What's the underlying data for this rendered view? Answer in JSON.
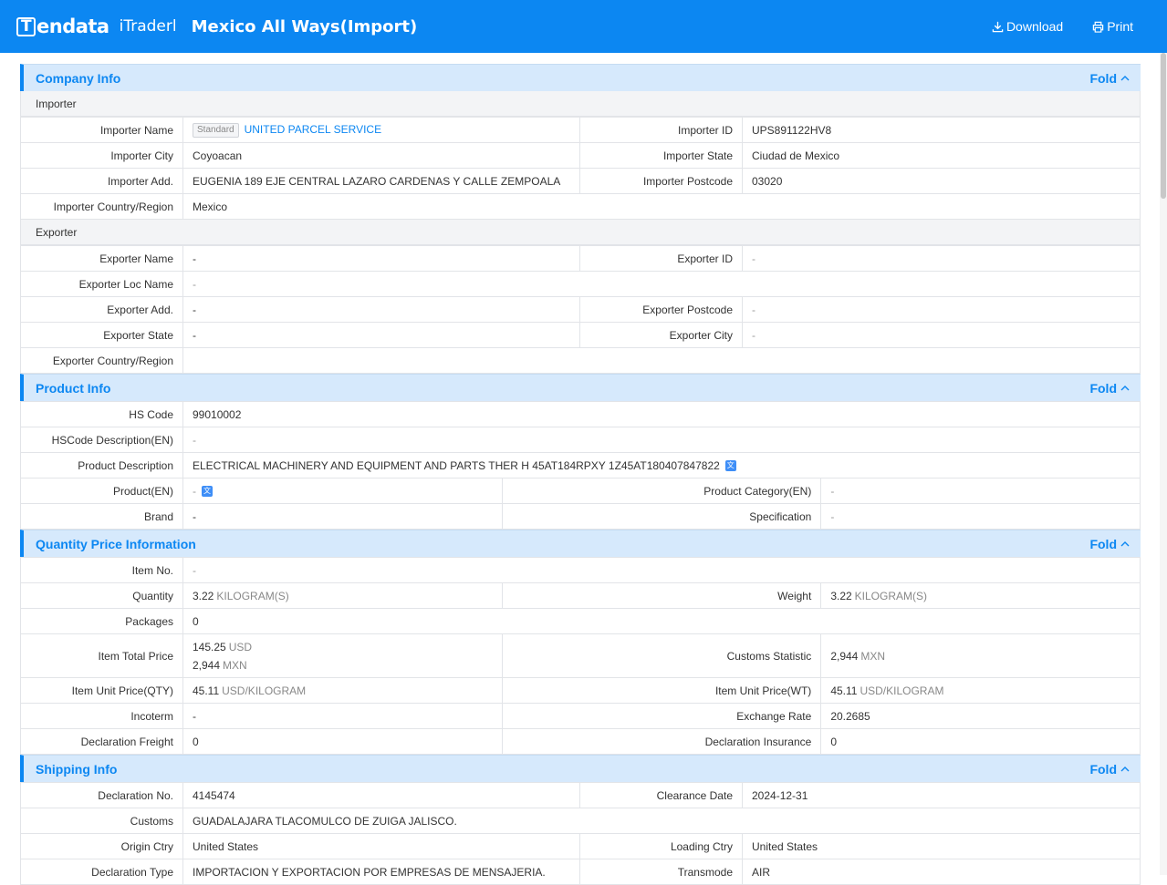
{
  "header": {
    "brand": "endata",
    "brand_letter": "T",
    "product": "iTraderl",
    "title": "Mexico All Ways(Import)",
    "download": "Download",
    "print": "Print"
  },
  "fold_label": "Fold",
  "company": {
    "title": "Company Info",
    "importer_sub": "Importer",
    "exporter_sub": "Exporter",
    "importer_name_label": "Importer Name",
    "importer_name_tag": "Standard",
    "importer_name": "UNITED PARCEL SERVICE",
    "importer_id_label": "Importer ID",
    "importer_id": "UPS891122HV8",
    "importer_city_label": "Importer City",
    "importer_city": "Coyoacan",
    "importer_state_label": "Importer State",
    "importer_state": "Ciudad de Mexico",
    "importer_add_label": "Importer Add.",
    "importer_add": "EUGENIA 189 EJE CENTRAL LAZARO CARDENAS Y CALLE ZEMPOALA",
    "importer_postcode_label": "Importer Postcode",
    "importer_postcode": "03020",
    "importer_country_label": "Importer Country/Region",
    "importer_country": "Mexico",
    "exporter_name_label": "Exporter Name",
    "exporter_name": "-",
    "exporter_id_label": "Exporter ID",
    "exporter_id": "-",
    "exporter_loc_label": "Exporter Loc Name",
    "exporter_loc": "-",
    "exporter_add_label": "Exporter Add.",
    "exporter_add": "-",
    "exporter_postcode_label": "Exporter Postcode",
    "exporter_postcode": "-",
    "exporter_state_label": "Exporter State",
    "exporter_state": "-",
    "exporter_city_label": "Exporter City",
    "exporter_city": "-",
    "exporter_country_label": "Exporter Country/Region",
    "exporter_country": ""
  },
  "product": {
    "title": "Product Info",
    "hs_label": "HS Code",
    "hs": "99010002",
    "hsdesc_label": "HSCode Description(EN)",
    "hsdesc": "-",
    "desc_label": "Product Description",
    "desc": "ELECTRICAL MACHINERY AND EQUIPMENT AND PARTS THER H 45AT184RPXY 1Z45AT180407847822",
    "product_en_label": "Product(EN)",
    "product_en": "-",
    "category_label": "Product Category(EN)",
    "category": "-",
    "brand_label": "Brand",
    "brand": "-",
    "spec_label": "Specification",
    "spec": "-",
    "translate_glyph": "文"
  },
  "quantity": {
    "title": "Quantity Price Information",
    "item_no_label": "Item No.",
    "item_no": "-",
    "qty_label": "Quantity",
    "qty": "3.22",
    "qty_unit": "KILOGRAM(S)",
    "weight_label": "Weight",
    "weight": "3.22",
    "weight_unit": "KILOGRAM(S)",
    "packages_label": "Packages",
    "packages": "0",
    "total_label": "Item Total Price",
    "total_usd": "145.25",
    "total_usd_unit": "USD",
    "total_mxn": "2,944",
    "total_mxn_unit": "MXN",
    "customs_stat_label": "Customs Statistic",
    "customs_stat": "2,944",
    "customs_stat_unit": "MXN",
    "unit_qty_label": "Item Unit Price(QTY)",
    "unit_qty": "45.11",
    "unit_qty_unit": "USD/KILOGRAM",
    "unit_wt_label": "Item Unit Price(WT)",
    "unit_wt": "45.11",
    "unit_wt_unit": "USD/KILOGRAM",
    "incoterm_label": "Incoterm",
    "incoterm": "-",
    "exchange_label": "Exchange Rate",
    "exchange": "20.2685",
    "freight_label": "Declaration Freight",
    "freight": "0",
    "insurance_label": "Declaration Insurance",
    "insurance": "0"
  },
  "shipping": {
    "title": "Shipping Info",
    "decl_no_label": "Declaration No.",
    "decl_no": "4145474",
    "clear_date_label": "Clearance Date",
    "clear_date": "2024-12-31",
    "customs_label": "Customs",
    "customs": "GUADALAJARA TLACOMULCO DE ZUIGA JALISCO.",
    "origin_label": "Origin Ctry",
    "origin": "United States",
    "loading_label": "Loading Ctry",
    "loading": "United States",
    "decl_type_label": "Declaration Type",
    "decl_type": "IMPORTACION Y EXPORTACION POR EMPRESAS DE MENSAJERIA.",
    "transmode_label": "Transmode",
    "transmode": "AIR"
  },
  "colors": {
    "accent": "#0c87f2",
    "section_bg": "#d6e9fc",
    "subhead_bg": "#f3f4f6"
  }
}
